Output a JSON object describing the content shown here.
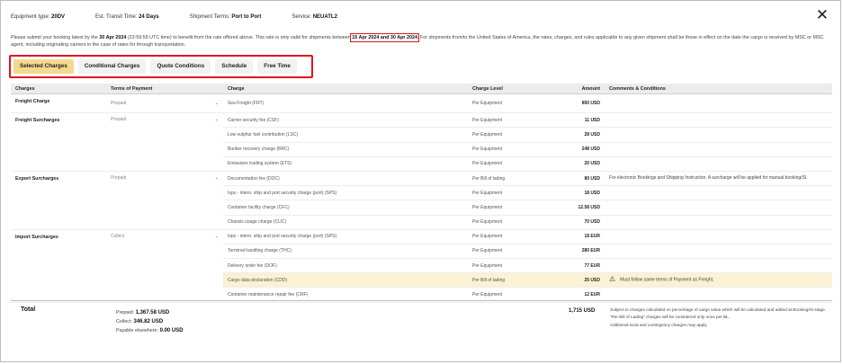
{
  "header": {
    "equipment_label": "Equipment type:",
    "equipment_value": "20DV",
    "transit_label": "Est. Transit Time:",
    "transit_value": "24 Days",
    "terms_label": "Shipment Terms:",
    "terms_value": "Port to Port",
    "service_label": "Service:",
    "service_value": "NEUATL2",
    "close_icon": "close-icon"
  },
  "notice": {
    "p1": "Please submit your booking latest by the",
    "deadline": "30 Apr 2024",
    "p2": "(23:59:59 UTC time) to benefit from the rate offered above. This rate is only valid for shipments between",
    "valid_range": "15 Apr 2024 and 30 Apr 2024",
    "p3": "For shipments from/to the United States of America, the rates, charges, and rules applicable to any given shipment shall be those in effect on the date the cargo is received by MSC or MSC agent, including originating carriers in the case of rates for through transportation."
  },
  "tabs": [
    {
      "label": "Selected Charges"
    },
    {
      "label": "Conditional Charges"
    },
    {
      "label": "Quote Conditions"
    },
    {
      "label": "Schedule"
    },
    {
      "label": "Free Time"
    }
  ],
  "table": {
    "headers": {
      "charges": "Charges",
      "terms": "Terms of Payment",
      "charge": "Charge",
      "level": "Charge Level",
      "amount": "Amount",
      "comments": "Comments & Conditions"
    },
    "groups": {
      "freight": {
        "name": "Freight Charge",
        "terms": "Prepaid"
      },
      "surcharges": {
        "name": "Freight Surcharges",
        "terms": "Prepaid"
      },
      "export": {
        "name": "Export Surcharges",
        "terms": "Prepaid"
      },
      "import": {
        "name": "Import Surcharges",
        "terms": "Collect"
      }
    },
    "rows": [
      {
        "charge": "Sea Freight (FRT)",
        "level": "Per Equipment",
        "amount": "850 USD",
        "comment": ""
      },
      {
        "charge": "Carrier security fee (CSF)",
        "level": "Per Equipment",
        "amount": "11 USD",
        "comment": ""
      },
      {
        "charge": "Low sulphur fuel contribution (LSC)",
        "level": "Per Equipment",
        "amount": "28 USD",
        "comment": ""
      },
      {
        "charge": "Bunker recovery charge (BRC)",
        "level": "Per Equipment",
        "amount": "248 USD",
        "comment": ""
      },
      {
        "charge": "Emissions trading system (ETS)",
        "level": "Per Equipment",
        "amount": "20 USD",
        "comment": ""
      },
      {
        "charge": "Documentation fee (DOC)",
        "level": "Per Bill of lading",
        "amount": "80 USD",
        "comment": "For electronic Bookings and Shipping Instruction. A surcharge will be applied for manual booking/SI."
      },
      {
        "charge": "Isps - intern. ship and port security charge (port) (SPS)",
        "level": "Per Equipment",
        "amount": "18 USD",
        "comment": ""
      },
      {
        "charge": "Container facility charge (CFC)",
        "level": "Per Equipment",
        "amount": "12.58 USD",
        "comment": ""
      },
      {
        "charge": "Chassis usage charge (CUC)",
        "level": "Per Equipment",
        "amount": "70 USD",
        "comment": ""
      },
      {
        "charge": "Isps - intern. ship and port security charge (port) (SPS)",
        "level": "Per Equipment",
        "amount": "18 EUR",
        "comment": ""
      },
      {
        "charge": "Terminal handling charge (THC)",
        "level": "Per Equipment",
        "amount": "280 EUR",
        "comment": ""
      },
      {
        "charge": "Delivery order fee (DOF)",
        "level": "Per Equipment",
        "amount": "77 EUR",
        "comment": ""
      },
      {
        "charge": "Cargo data declaration (CDD)",
        "level": "Per Bill of lading",
        "amount": "25 USD",
        "comment": "Must follow same terms of Payment as Freight."
      },
      {
        "charge": "Container maintenance repair fee (CRF)",
        "level": "Per Equipment",
        "amount": "12 EUR",
        "comment": ""
      }
    ]
  },
  "total": {
    "label": "Total",
    "prepaid_label": "Prepaid:",
    "prepaid_value": "1,367.58 USD",
    "collect_label": "Collect:",
    "collect_value": "346.82 USD",
    "elsewhere_label": "Payable elsewhere:",
    "elsewhere_value": "0.00 USD",
    "amount": "1,715 USD",
    "notes": [
      "Subject to charges calculated on percentage of cargo value which will be calculated and added at Booking/SI stage.",
      "\"Per Bill of Lading\" charges will be considered only once per BL.",
      "Additional local and contingency charges may apply."
    ]
  }
}
